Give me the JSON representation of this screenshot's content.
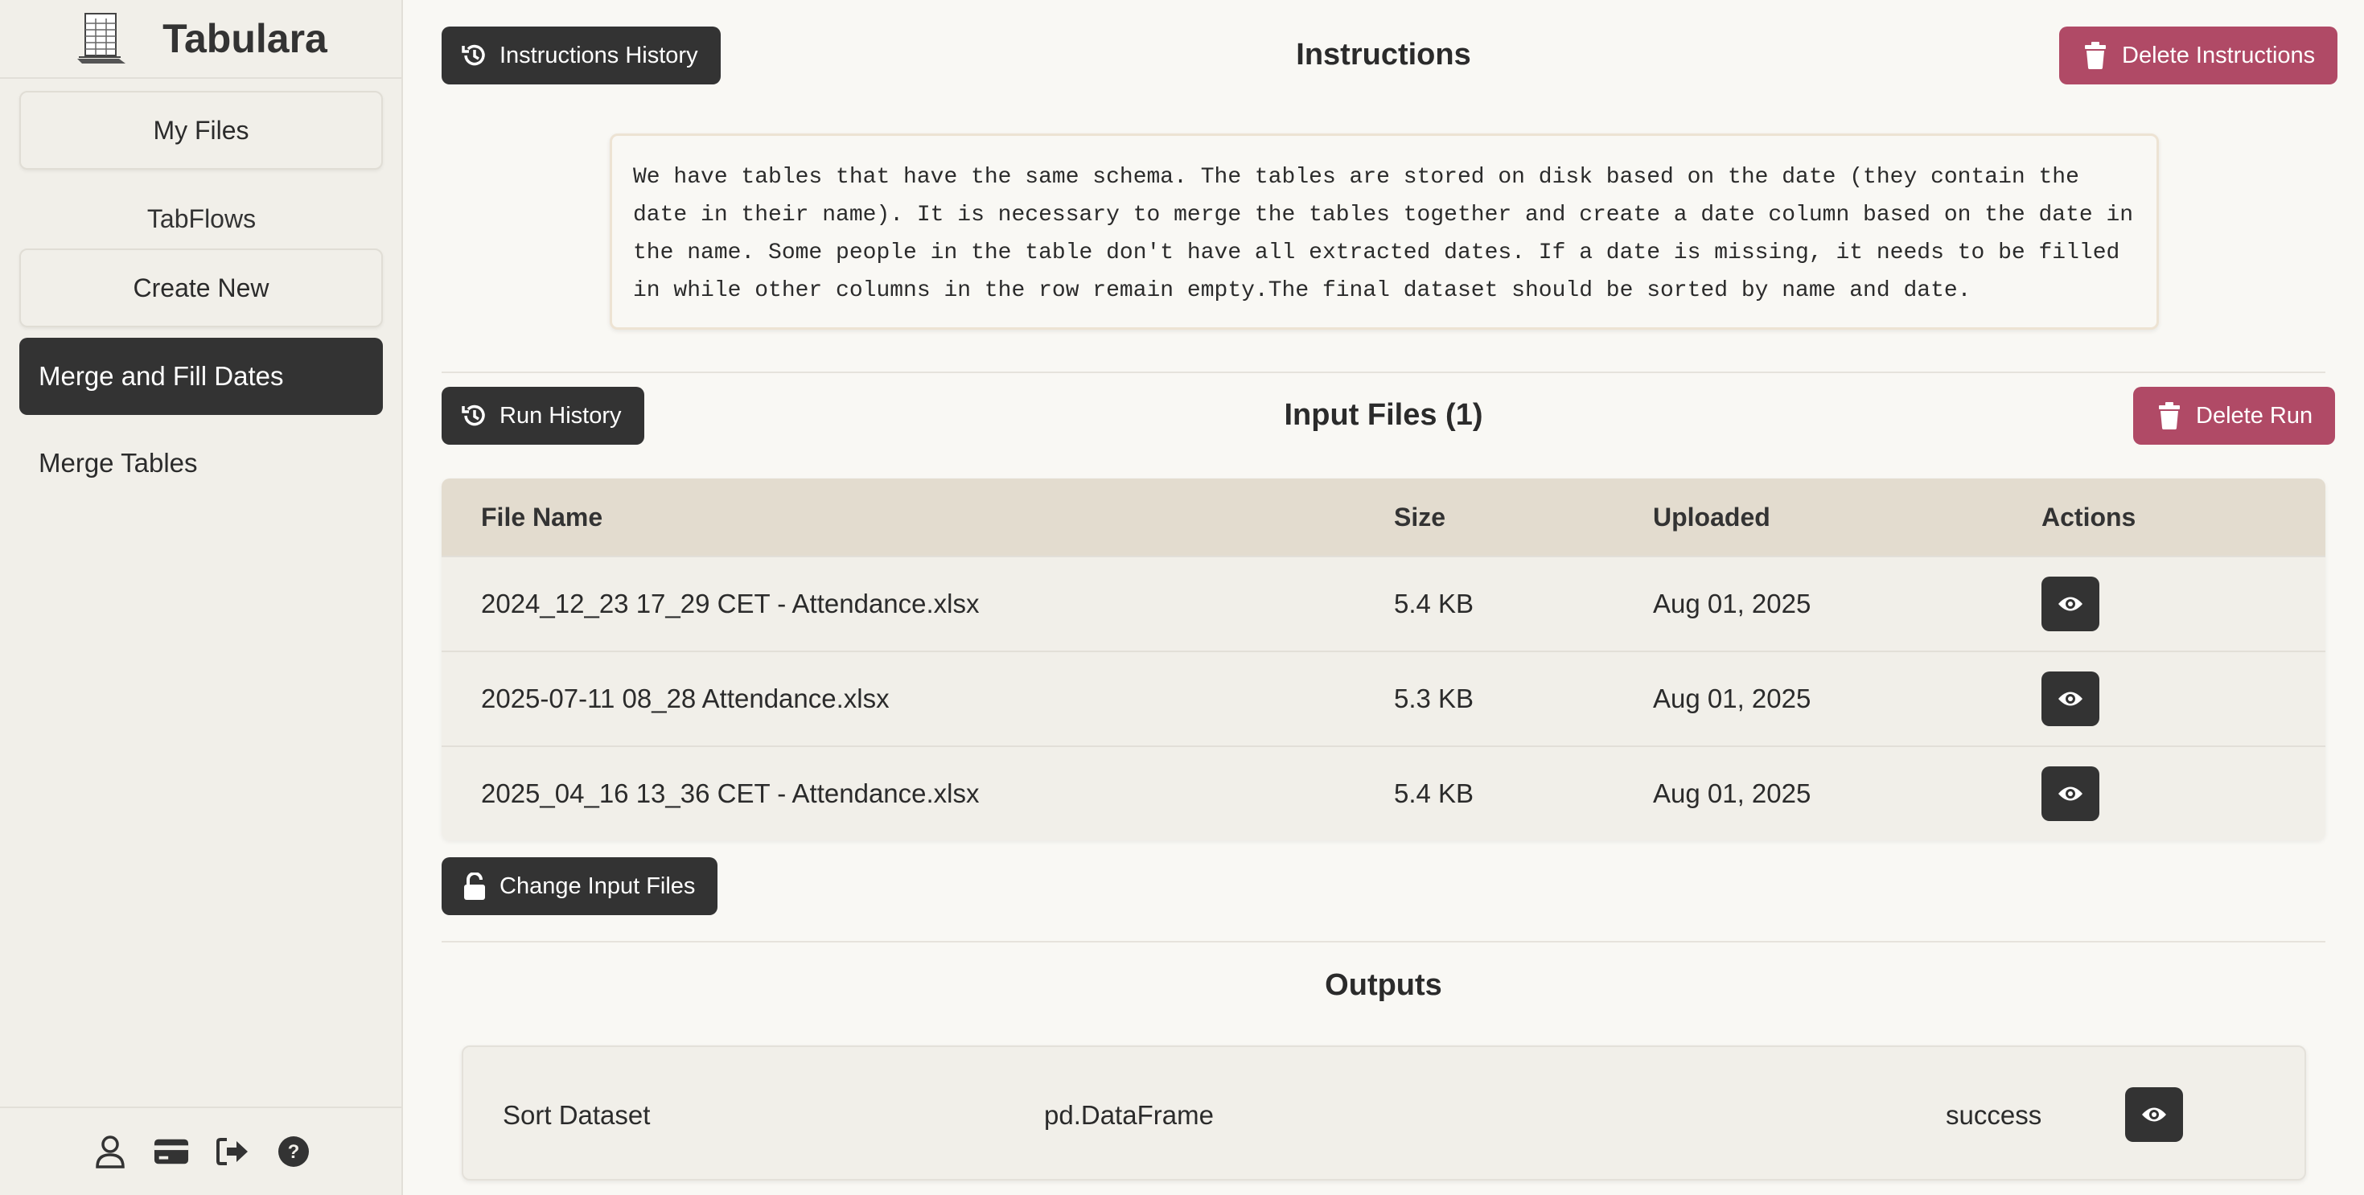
{
  "app": {
    "name": "Tabulara"
  },
  "sidebar": {
    "my_files": "My Files",
    "section_label": "TabFlows",
    "create_new": "Create New",
    "items": [
      {
        "label": "Merge and Fill Dates",
        "active": true
      },
      {
        "label": "Merge Tables",
        "active": false
      }
    ],
    "footer_icons": [
      "user-icon",
      "credit-card-icon",
      "logout-icon",
      "help-icon"
    ]
  },
  "instructions": {
    "history_button": "Instructions History",
    "title": "Instructions",
    "delete_button": "Delete Instructions",
    "lines": [
      "We have tables that have the same schema. The tables are stored on disk based on the date (they contain the",
      "date in their name). It is necessary to merge the tables together and create a date column based on the date in",
      "the name. Some people in the table don't have all extracted dates. If a date is missing, it needs to be filled",
      "in while other columns in the row remain empty.The final dataset should be sorted by name and date."
    ]
  },
  "input_files": {
    "history_button": "Run History",
    "title": "Input Files (1)",
    "delete_button": "Delete Run",
    "columns": [
      "File Name",
      "Size",
      "Uploaded",
      "Actions"
    ],
    "rows": [
      {
        "name": "2024_12_23 17_29 CET - Attendance.xlsx",
        "size": "5.4 KB",
        "uploaded": "Aug 01, 2025"
      },
      {
        "name": "2025-07-11 08_28 Attendance.xlsx",
        "size": "5.3 KB",
        "uploaded": "Aug 01, 2025"
      },
      {
        "name": "2025_04_16 13_36 CET - Attendance.xlsx",
        "size": "5.4 KB",
        "uploaded": "Aug 01, 2025"
      }
    ],
    "change_button": "Change Input Files"
  },
  "outputs": {
    "title": "Outputs",
    "items": [
      {
        "name": "Sort Dataset",
        "type": "pd.DataFrame",
        "status": "success"
      }
    ]
  },
  "colors": {
    "dark": "#333333",
    "danger": "#b04a66",
    "header_bg": "#e3dccf",
    "sidebar_bg": "#f1efe9",
    "page_bg": "#f9f8f4"
  }
}
